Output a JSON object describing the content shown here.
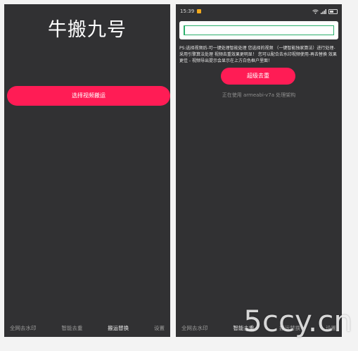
{
  "left_phone": {
    "app_title": "牛搬九号",
    "select_video_button": "选择视频搬运",
    "nav": {
      "watermark": "全网去水印",
      "smart_dedup": "智能去重",
      "move_replace": "搬运替换",
      "settings": "设置"
    }
  },
  "right_phone": {
    "status": {
      "time": "15:39",
      "icons": [
        "wifi-icon",
        "signal-icon",
        "battery-icon"
      ]
    },
    "input": {
      "value": "",
      "placeholder": ""
    },
    "notice": "PS:选择视频后-可一键处理智能处理 您选择的视频 （一键智能独家算法）进行处理-采用引擎算法处理 视频去重效果更明显！ 您可以配合去水印视频使用-再去替换 效果更佳 - 视频导出提示会显示在上方白色框户里面！",
    "super_dedup_button": "超级去重",
    "engine_info": "正在使用 armeabi-v7a 处理架构",
    "nav": {
      "watermark": "全网去水印",
      "smart_dedup": "智能去重",
      "move_replace": "搬运替换",
      "settings": "设置"
    }
  },
  "watermark_text": "5ccy.cn",
  "colors": {
    "accent": "#ff1c55",
    "screen_bg": "#313133",
    "input_border": "#2bb06c"
  }
}
